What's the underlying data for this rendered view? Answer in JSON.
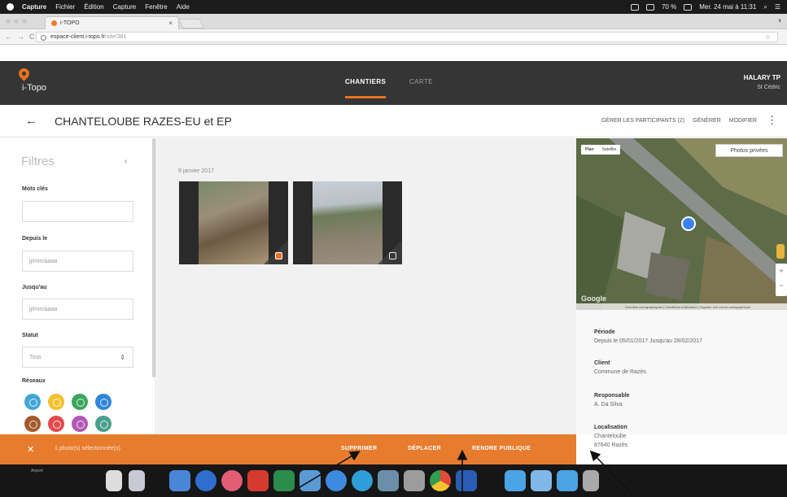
{
  "menubar": {
    "items": [
      "Capture",
      "Fichier",
      "Édition",
      "Capture",
      "Fenêtre",
      "Aide"
    ],
    "battery": "70 %",
    "clock": "Mer. 24 mai à 11:31"
  },
  "browser": {
    "tab_title": "i-TOPO",
    "url_host": "espace-client.i-topo.fr",
    "url_path": "/site/381"
  },
  "header": {
    "logo_text": "i-Topo",
    "nav": [
      "CHANTIERS",
      "CARTE"
    ],
    "account_name": "HALARY TP",
    "account_sub": "St Cédric"
  },
  "page": {
    "back": "←",
    "title": "CHANTELOUBE RAZES-EU et EP",
    "actions": [
      "GÉRER LES PARTICIPANTS (2)",
      "GÉNÉRER",
      "MODIFIER"
    ],
    "more": "⋮"
  },
  "filters": {
    "title": "Filtres",
    "collapse": "‹",
    "keywords_label": "Mots clés",
    "keywords_value": "",
    "from_label": "Depuis le",
    "from_placeholder": "jj/mm/aaaa",
    "to_label": "Jusqu'au",
    "to_placeholder": "jj/mm/aaaa",
    "status_label": "Statut",
    "status_value": "Tous",
    "status_caret": "⇕",
    "networks_label": "Réseaux",
    "network_colors": [
      "#3fa7d6",
      "#f2c12e",
      "#3aa55d",
      "#2f87d8",
      "#a5582a",
      "#e34b4b",
      "#b157b8",
      "#4a9e8c"
    ]
  },
  "gallery": {
    "date": "9 janvier 2017"
  },
  "map": {
    "tab_plan": "Plan",
    "tab_sat": "Satellite",
    "private_btn": "Photos privées",
    "google": "Google",
    "copyright": "Données cartographiques | Conditions d'utilisation | Signaler une erreur cartographique",
    "zoom_in": "+",
    "zoom_out": "−"
  },
  "details": {
    "period_label": "Période",
    "period_value": "Depuis le 05/01/2017 Jusqu'au 28/02/2017",
    "client_label": "Client",
    "client_value": "Commune de Razès",
    "resp_label": "Responsable",
    "resp_value": "A. Da Silva",
    "loc_label": "Localisation",
    "loc_value1": "Chanteloube",
    "loc_value2": "87640 Razès"
  },
  "actionbar": {
    "close": "✕",
    "count": "1 photo(s) sélectionnée(s)",
    "delete": "SUPPRIMER",
    "move": "DÉPLACER",
    "public": "RENDRE PUBLIQUE"
  },
  "dock": {
    "label": "Airport"
  }
}
